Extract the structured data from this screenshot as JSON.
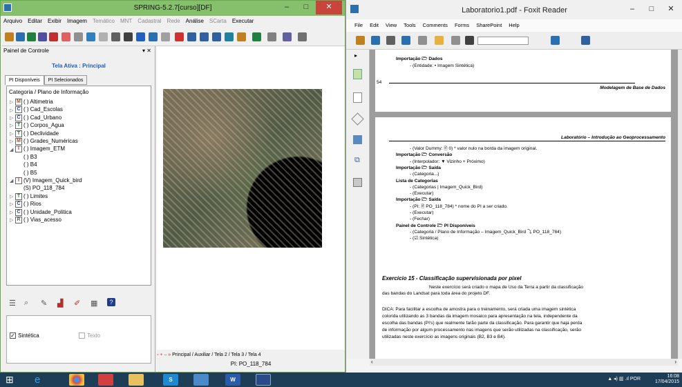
{
  "spring": {
    "title": "SPRING-5.2.7[curso][DF]",
    "menu": [
      "Arquivo",
      "Editar",
      "Exibir",
      "Imagem",
      "Temático",
      "MNT",
      "Cadastral",
      "Rede",
      "Análise",
      "SCarta",
      "Executar"
    ],
    "panel_title": "Painel de Controle",
    "tela_ativa": "Tela Ativa : Principal",
    "tabs": [
      "PI Disponíveis",
      "PI Selecionados"
    ],
    "tree_header": "Categoria / Plano de Informação",
    "tree": [
      {
        "icon": "M",
        "label": "( ) Altimetria",
        "color": "#a05020",
        "indent": 0,
        "exp": "▷"
      },
      {
        "icon": "C",
        "label": "( ) Cad_Escolas",
        "color": "#2040a0",
        "indent": 0,
        "exp": "▷"
      },
      {
        "icon": "C",
        "label": "( ) Cad_Urbano",
        "color": "#2040a0",
        "indent": 0,
        "exp": "▷"
      },
      {
        "icon": "T",
        "label": "( ) Corpos_Agua",
        "color": "#208040",
        "indent": 0,
        "exp": "▷"
      },
      {
        "icon": "T",
        "label": "( ) Declividade",
        "color": "#208040",
        "indent": 0,
        "exp": "▷"
      },
      {
        "icon": "M",
        "label": "( ) Grades_Numéricas",
        "color": "#a05020",
        "indent": 0,
        "exp": "▷"
      },
      {
        "icon": "I",
        "label": "( ) Imagem_ETM",
        "color": "#c02020",
        "indent": 0,
        "exp": "◢"
      },
      {
        "icon": "",
        "label": "( ) B3",
        "color": "",
        "indent": 1,
        "exp": ""
      },
      {
        "icon": "",
        "label": "( ) B4",
        "color": "",
        "indent": 1,
        "exp": ""
      },
      {
        "icon": "",
        "label": "( ) B5",
        "color": "",
        "indent": 1,
        "exp": ""
      },
      {
        "icon": "I",
        "label": "(V) Imagem_Quick_bird",
        "color": "#c02020",
        "indent": 0,
        "exp": "◢"
      },
      {
        "icon": "",
        "label": "(S) PO_118_784",
        "color": "",
        "indent": 1,
        "exp": ""
      },
      {
        "icon": "T",
        "label": "( ) Limites",
        "color": "#208040",
        "indent": 0,
        "exp": "▷"
      },
      {
        "icon": "C",
        "label": "( ) Rios",
        "color": "#2040a0",
        "indent": 0,
        "exp": "▷"
      },
      {
        "icon": "C",
        "label": "( ) Unidade_Politica",
        "color": "#2040a0",
        "indent": 0,
        "exp": "▷"
      },
      {
        "icon": "R",
        "label": "( ) Vias_acesso",
        "color": "#606060",
        "indent": 0,
        "exp": "▷"
      }
    ],
    "sintetica": "Sintética",
    "texto": "Texto",
    "btabs": "Principal / Auxiliar / Tela 2 / Tela 3 / Tela 4",
    "pi_label": "PI: PO_118_784"
  },
  "foxit": {
    "title": "Laboratorio1.pdf - Foxit Reader",
    "menu": [
      "File",
      "Edit",
      "View",
      "Tools",
      "Comments",
      "Forms",
      "SharePoint",
      "Help"
    ],
    "p1": [
      "Importação 🗁 Dados",
      "- (Entidade: • Imagem Sintética)"
    ],
    "p1_num": "54",
    "p1_footer": "Modelagem de Base de Dados",
    "p2_header": "Laboratório – Introdução ao Geoprocessamento",
    "p2": [
      {
        "t": "- (Valor Dummy: 🖹 0)  * valor nulo na borda da imagem original.",
        "b": false,
        "x": 50
      },
      {
        "t": "Importação 🗁 Conversão",
        "b": true,
        "x": 30
      },
      {
        "t": "- (Interpolador: ▼ Vizinho + Próximo)",
        "b": false,
        "x": 50
      },
      {
        "t": "Importação 🗁 Saída",
        "b": true,
        "x": 30
      },
      {
        "t": "- (Categoria...)",
        "b": false,
        "x": 50
      },
      {
        "t": "Lista de Categorias",
        "b": true,
        "x": 30
      },
      {
        "t": "- (Categorias | Imagem_Quick_Bird)",
        "b": false,
        "x": 50
      },
      {
        "t": "- (Executar)",
        "b": false,
        "x": 50
      },
      {
        "t": "Importação 🗁 Saída",
        "b": true,
        "x": 30
      },
      {
        "t": "- (PI: 🖹 PO_118_784)  * nome do PI a ser criado.",
        "b": false,
        "x": 50
      },
      {
        "t": "- (Executar)",
        "b": false,
        "x": 50
      },
      {
        "t": "- (Fechar)",
        "b": false,
        "x": 50
      },
      {
        "t": "Painel de Controle 🗁 PI Disponíveis",
        "b": true,
        "x": 30
      },
      {
        "t": "- (Categoria / Plano de Informação – Imagem_Quick_Bird ⤵ PO_118_784)",
        "b": false,
        "x": 50
      },
      {
        "t": "- (☑ Sintética)",
        "b": false,
        "x": 50
      }
    ],
    "ex_title": "Exercício 15 - Classificação supervisionada por pixel",
    "ex_p1": "Neste exercício será criado o mapa de Uso da Terra a partir da classificação",
    "ex_p2": "das bandas do Landsat para toda área do projeto DF.",
    "dica": [
      "DICA:  Para facilitar a escolha de amostra para o treinamento, será criada uma imagem sintética",
      "colorida utilizando as 3 bandas da imagem mosaico para apresentação na tela, independente da",
      "escolha das bandas (PI's) que realmente farão parte da classificação. Para garantir que haja perda",
      "de informação por algum processamento nas imagens que serão utilizadas na classificação, serão",
      "utilizadas neste exercício as imagens originais (B2, B3 e B4)."
    ]
  },
  "tray": {
    "lang": "POR",
    "time": "16:08",
    "date": "17/04/2015"
  }
}
